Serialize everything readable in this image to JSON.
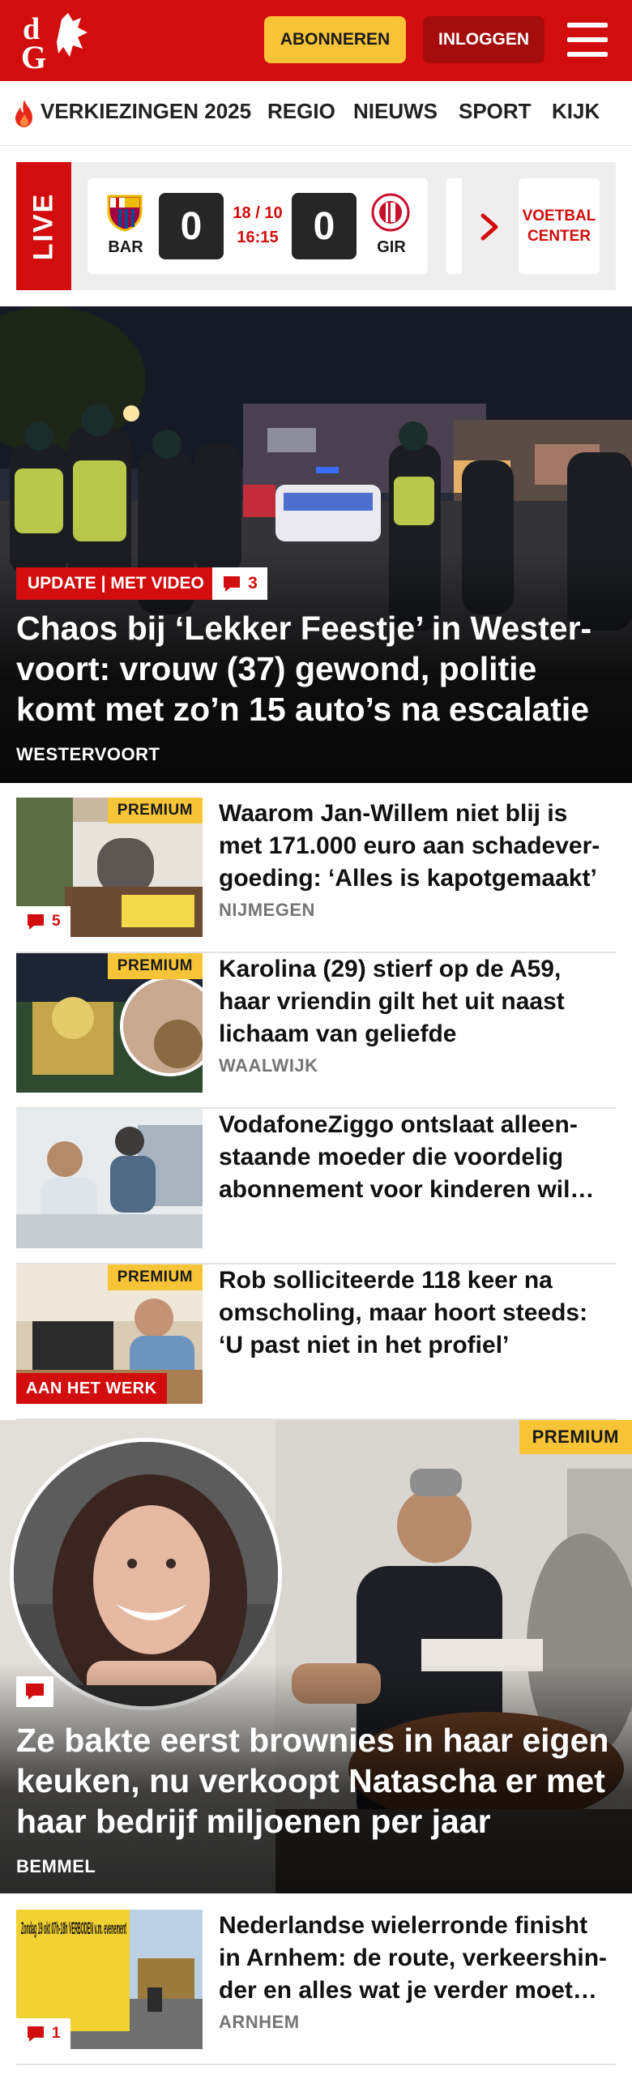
{
  "header": {
    "logo_text": "dG",
    "subscribe_label": "ABONNEREN",
    "login_label": "INLOGGEN",
    "brand_color": "#d20d0d",
    "accent_color": "#f7c437"
  },
  "nav": {
    "items": [
      {
        "label": "VERKIEZINGEN 2025",
        "icon": "flame-icon"
      },
      {
        "label": "REGIO"
      },
      {
        "label": "NIEUWS"
      },
      {
        "label": "SPORT"
      },
      {
        "label": "KIJK"
      }
    ]
  },
  "live": {
    "label": "LIVE",
    "match": {
      "home_code": "BAR",
      "away_code": "GIR",
      "home_score": "0",
      "away_score": "0",
      "date": "18 / 10",
      "time": "16:15"
    },
    "voetbal_center_label": "VOETBAL CENTER"
  },
  "hero": {
    "badge": "UPDATE | MET VIDEO",
    "comments": "3",
    "title": "Chaos bij ‘Lekker Feestje’ in Wester­voort: vrouw (37) gewond, politie komt met zo’n 15 auto’s na escalatie",
    "location": "WESTERVOORT"
  },
  "articles": [
    {
      "title": "Waarom Jan-Willem niet blij is met 171.000 euro aan schadever­goeding: ‘Alles is kapotgemaakt’",
      "location": "NIJMEGEN",
      "premium": "PREMIUM",
      "comments": "5"
    },
    {
      "title": "Karolina (29) stierf op de A59, haar vriendin gilt het uit naast lichaam van geliefde",
      "location": "WAALWIJK",
      "premium": "PREMIUM"
    },
    {
      "title": "VodafoneZiggo ontslaat alleen­staande moeder die voordelig abonnement voor kinderen wil…"
    },
    {
      "title": "Rob solliciteerde 118 keer na omscholing, maar hoort steeds: ‘U past niet in het profiel’",
      "premium": "PREMIUM",
      "section": "AAN HET WERK"
    }
  ],
  "feature": {
    "premium": "PREMIUM",
    "title": "Ze bakte eerst brownies in haar eigen keuken, nu verkoopt Natascha er met haar bedrijf miljoenen per jaar",
    "location": "BEMMEL"
  },
  "bottom_article": {
    "title": "Nederlandse wielerronde finisht in Arnhem: de route, verkeershin­der en alles wat je verder moet…",
    "location": "ARNHEM",
    "comments": "1",
    "sign_text": "Zondag 19 okt 07h-18h VERBODEN v.m. evenement"
  }
}
